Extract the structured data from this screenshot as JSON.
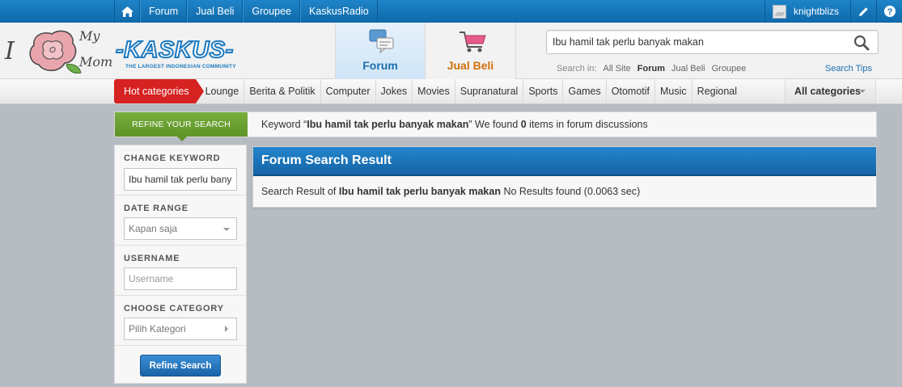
{
  "topnav": {
    "items": [
      "Forum",
      "Jual Beli",
      "Groupee",
      "KaskusRadio"
    ],
    "username": "knightblizs"
  },
  "logo": {
    "left_letter": "I",
    "my": "My",
    "mom": "Mom",
    "brand": "-KASKUS-",
    "tagline": "THE LARGEST INDONESIAN COMMUNITY"
  },
  "tabs": {
    "forum": "Forum",
    "jual_beli": "Jual Beli"
  },
  "search": {
    "value": "Ibu hamil tak perlu banyak makan",
    "search_in_label": "Search in:",
    "options": [
      "All Site",
      "Forum",
      "Jual Beli",
      "Groupee"
    ],
    "active_option": "Forum",
    "tips": "Search Tips"
  },
  "categories": {
    "hot": "Hot categories",
    "items": [
      "Lounge",
      "Berita & Politik",
      "Computer",
      "Jokes",
      "Movies",
      "Supranatural",
      "Sports",
      "Games",
      "Otomotif",
      "Music",
      "Regional"
    ],
    "all": "All categories"
  },
  "refine": {
    "tab": "REFINE YOUR SEARCH",
    "msg_prefix": "Keyword “",
    "msg_keyword": "Ibu hamil tak perlu banyak makan",
    "msg_middle": "” We found ",
    "msg_count": "0",
    "msg_suffix": " items in forum discussions"
  },
  "sidebar": {
    "change_keyword_title": "CHANGE KEYWORD",
    "keyword_value": "Ibu hamil tak perlu banyak makan",
    "date_range_title": "DATE RANGE",
    "date_range_value": "Kapan saja",
    "username_title": "USERNAME",
    "username_placeholder": "Username",
    "category_title": "CHOOSE CATEGORY",
    "category_value": "Pilih Kategori",
    "refine_button": "Refine Search"
  },
  "result": {
    "title": "Forum Search Result",
    "body_prefix": "Search Result of ",
    "body_keyword": "Ibu hamil tak perlu banyak makan",
    "body_suffix": " No Results found (0.0063 sec)"
  },
  "colors": {
    "topbar": "#1475b8",
    "hot_category": "#d72222",
    "refine_tab": "#6aa232",
    "result_header": "#1c74bb",
    "jual_beli": "#d2700a"
  }
}
